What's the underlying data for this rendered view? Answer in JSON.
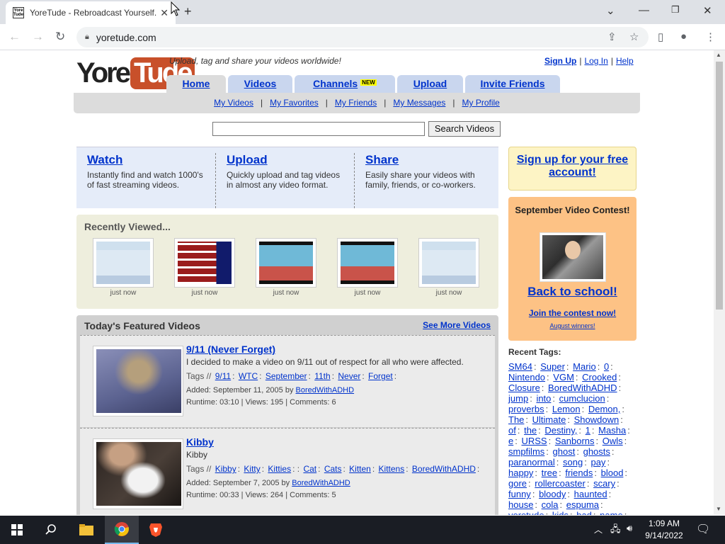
{
  "browser": {
    "tab_title": "YoreTude - Rebroadcast Yourself.",
    "favicon_text": "Yore Tude",
    "url": "yoretude.com"
  },
  "site": {
    "logo_left": "Yore",
    "logo_right": "Tude",
    "tagline": "Upload, tag and share your videos worldwide!",
    "top_links": [
      "Sign Up",
      "Log In",
      "Help"
    ],
    "nav_tabs": [
      {
        "label": "Home",
        "active": true
      },
      {
        "label": "Videos",
        "active": false
      },
      {
        "label": "Channels",
        "active": false,
        "badge": "NEW"
      },
      {
        "label": "Upload",
        "active": false
      },
      {
        "label": "Invite Friends",
        "active": false
      }
    ],
    "sub_nav": [
      "My Videos",
      "My Favorites",
      "My Friends",
      "My Messages",
      "My Profile"
    ],
    "search": {
      "button_label": "Search Videos",
      "value": ""
    }
  },
  "wus": [
    {
      "title": "Watch",
      "desc": "Instantly find and watch 1000's of fast streaming videos."
    },
    {
      "title": "Upload",
      "desc": "Quickly upload and tag videos in almost any video format."
    },
    {
      "title": "Share",
      "desc": "Easily share your videos with family, friends, or co-workers."
    }
  ],
  "signup_box": "Sign up for your free account!",
  "recently_viewed": {
    "heading": "Recently Viewed...",
    "items": [
      {
        "caption": "just now",
        "thumb": "screenshot"
      },
      {
        "caption": "just now",
        "thumb": "grid"
      },
      {
        "caption": "just now",
        "thumb": "game"
      },
      {
        "caption": "just now",
        "thumb": "game"
      },
      {
        "caption": "just now",
        "thumb": "screenshot"
      }
    ]
  },
  "contest": {
    "heading": "September Video Contest!",
    "title": "Back to school!",
    "join": "Join the contest now!",
    "winners": "August winners!"
  },
  "featured": {
    "heading": "Today's Featured Videos",
    "more": "See More Videos",
    "videos": [
      {
        "title": "9/11 (Never Forget)",
        "desc": "I decided to make a video on 9/11 out of respect for all who were affected.",
        "tags": [
          "9/11",
          "WTC",
          "September",
          "11th",
          "Never",
          "Forget"
        ],
        "added_label": "Added: September 11, 2005 by",
        "user": "BoredWithADHD",
        "stats": "Runtime: 03:10 | Views: 195 | Comments: 6"
      },
      {
        "title": "Kibby",
        "desc": "Kibby",
        "tags": [
          "Kibby",
          "Kitty",
          "Kitties",
          "",
          "Cat",
          "Cats",
          "Kitten",
          "Kittens",
          "BoredWithADHD"
        ],
        "added_label": "Added: September 7, 2005 by",
        "user": "BoredWithADHD",
        "stats": "Runtime: 00:33 | Views: 264 | Comments: 5"
      }
    ]
  },
  "recent_tags": {
    "heading": "Recent Tags:",
    "tags": [
      "SM64",
      "Super",
      "Mario",
      "0",
      "Nintendo",
      "VGM",
      "Crooked",
      "Closure",
      "BoredWithADHD",
      "jump",
      "into",
      "cumclucion",
      "proverbs",
      "Lemon",
      "Demon,",
      "The",
      "Ultimate",
      "Showdown",
      "of",
      "the",
      "Destiny,",
      "1",
      "Masha",
      "e",
      "URSS",
      "Sanborns",
      "Owls",
      "smpfilms",
      "ghost",
      "ghosts",
      "paranormal",
      "song",
      "pay",
      "happy",
      "tree",
      "friends",
      "blood",
      "gore",
      "rollercoaster",
      "scary",
      "funny",
      "bloody",
      "haunted",
      "house",
      "cola",
      "espuma",
      "yoretude",
      "kids",
      "bad",
      "name"
    ]
  },
  "taskbar": {
    "time": "1:09 AM",
    "date": "9/14/2022"
  },
  "colors": {
    "link": "#0033cc",
    "tab_blue": "#c9d6ee",
    "tab_active": "#dcdcdc",
    "signup_bg": "#fdf4c5",
    "contest_bg": "#fdc285",
    "recent_bg": "#eeeedd",
    "featured_bg": "#d0d0d0",
    "logo_orange": "#c8502a"
  },
  "labels": {
    "tags_prefix": "Tags //",
    "pipe": "|",
    "x_glyph": "✕"
  }
}
